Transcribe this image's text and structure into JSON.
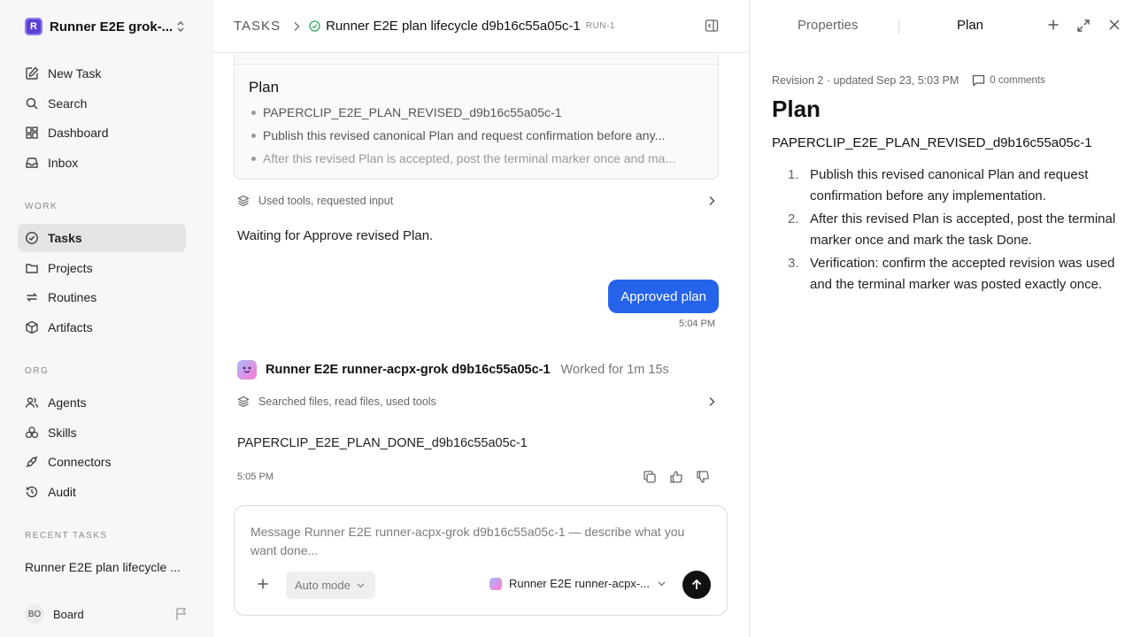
{
  "sidebar": {
    "workspace": {
      "logo": "R",
      "name": "Runner E2E grok-..."
    },
    "top_nav": [
      {
        "label": "New Task",
        "icon": "new-task-icon"
      },
      {
        "label": "Search",
        "icon": "search-icon"
      },
      {
        "label": "Dashboard",
        "icon": "dashboard-icon"
      },
      {
        "label": "Inbox",
        "icon": "inbox-icon"
      }
    ],
    "work_label": "WORK",
    "work_nav": [
      {
        "label": "Tasks",
        "icon": "tasks-icon",
        "active": true
      },
      {
        "label": "Projects",
        "icon": "folder-icon"
      },
      {
        "label": "Routines",
        "icon": "routines-icon"
      },
      {
        "label": "Artifacts",
        "icon": "box-icon"
      }
    ],
    "org_label": "ORG",
    "org_nav": [
      {
        "label": "Agents",
        "icon": "users-icon"
      },
      {
        "label": "Skills",
        "icon": "skills-icon"
      },
      {
        "label": "Connectors",
        "icon": "plug-icon"
      },
      {
        "label": "Audit",
        "icon": "history-icon"
      }
    ],
    "recent_label": "RECENT TASKS",
    "recent_tasks": [
      "Runner E2E plan lifecycle ..."
    ],
    "board": {
      "initials": "BO",
      "name": "Board"
    }
  },
  "main": {
    "breadcrumb": {
      "root": "TASKS",
      "title": "Runner E2E plan lifecycle d9b16c55a05c-1",
      "id": "RUN-1"
    },
    "plan_card": {
      "heading": "Plan",
      "items": [
        "PAPERCLIP_E2E_PLAN_REVISED_d9b16c55a05c-1",
        "Publish this revised canonical Plan and request confirmation before any...",
        "After this revised Plan is accepted, post the terminal marker once and ma..."
      ]
    },
    "tool_summary_1": "Used tools, requested input",
    "waiting_text": "Waiting for Approve revised Plan.",
    "user_message": {
      "text": "Approved plan",
      "time": "5:04 PM"
    },
    "agent_message": {
      "name": "Runner E2E runner-acpx-grok d9b16c55a05c-1",
      "worked": "Worked for 1m 15s",
      "tool_summary": "Searched files, read files, used tools",
      "text": "PAPERCLIP_E2E_PLAN_DONE_d9b16c55a05c-1",
      "time": "5:05 PM"
    },
    "composer": {
      "placeholder": "Message Runner E2E runner-acpx-grok d9b16c55a05c-1 — describe what you want done...",
      "mode": "Auto mode",
      "agent": "Runner E2E runner-acpx-..."
    }
  },
  "right_panel": {
    "tabs": [
      "Properties",
      "Plan"
    ],
    "active_tab": "Plan",
    "revision_line": "Revision 2 · updated Sep 23, 5:03 PM",
    "comments": "0 comments",
    "title": "Plan",
    "marker": "PAPERCLIP_E2E_PLAN_REVISED_d9b16c55a05c-1",
    "steps": [
      {
        "num": "1.",
        "text": "Publish this revised canonical Plan and request confirmation before any implementation."
      },
      {
        "num": "2.",
        "text": "After this revised Plan is accepted, post the terminal marker once and mark the task Done."
      },
      {
        "num": "3.",
        "text": "Verification: confirm the accepted revision was used and the terminal marker was posted exactly once."
      }
    ]
  },
  "colors": {
    "accent": "#2563eb",
    "success": "#3aa85f",
    "workspace": "#5b3fd6"
  }
}
